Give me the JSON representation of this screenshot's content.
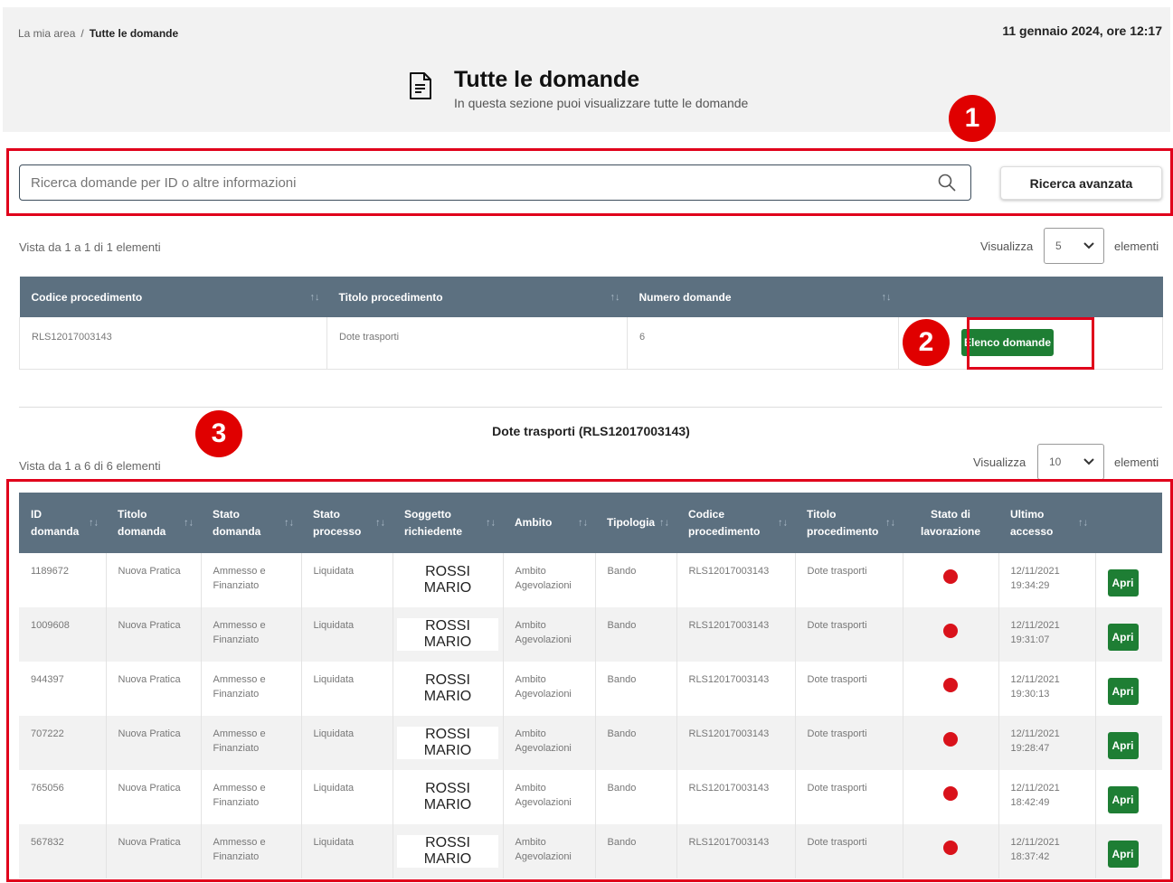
{
  "breadcrumb": {
    "home": "La mia area",
    "separator": "/",
    "current": "Tutte le domande"
  },
  "datetime": "11 gennaio 2024, ore 12:17",
  "header": {
    "title": "Tutte le domande",
    "subtitle": "In questa sezione puoi visualizzare tutte le domande"
  },
  "markers": [
    "1",
    "2",
    "3"
  ],
  "search": {
    "placeholder": "Ricerca domande per ID o altre informazioni",
    "advanced_label": "Ricerca avanzata"
  },
  "procedures": {
    "info": "Vista da 1 a 1 di 1 elementi",
    "show_label": "Visualizza",
    "page_size": "5",
    "elements_label": "elementi",
    "columns": [
      "Codice procedimento",
      "Titolo procedimento",
      "Numero domande"
    ],
    "rows": [
      {
        "codice": "RLS12017003143",
        "titolo": "Dote trasporti",
        "numero": "6",
        "action": "Elenco domande"
      }
    ]
  },
  "section_title": "Dote trasporti (RLS12017003143)",
  "applications": {
    "info": "Vista da 1 a 6 di 6 elementi",
    "show_label": "Visualizza",
    "page_size": "10",
    "elements_label": "elementi",
    "columns": [
      [
        "ID",
        "domanda"
      ],
      [
        "Titolo",
        "domanda"
      ],
      [
        "Stato",
        "domanda"
      ],
      [
        "Stato",
        "processo"
      ],
      [
        "Soggetto",
        "richiedente"
      ],
      [
        "Ambito",
        ""
      ],
      [
        "Tipologia",
        ""
      ],
      [
        "Codice",
        "procedimento"
      ],
      [
        "Titolo",
        "procedimento"
      ],
      [
        "Stato di",
        "lavorazione"
      ],
      [
        "Ultimo",
        "accesso"
      ]
    ],
    "status_color": "#d9121b",
    "action_label": "Apri",
    "rows": [
      {
        "id": "1189672",
        "titolo": "Nuova Pratica",
        "stato1": "Ammesso e",
        "stato2": "Finanziato",
        "processo": "Liquidata",
        "sog1": "ROSSI",
        "sog2": "MARIO",
        "amb1": "Ambito",
        "amb2": "Agevolazioni",
        "tipologia": "Bando",
        "codice": "RLS12017003143",
        "titolo_proc": "Dote trasporti",
        "data": "12/11/2021",
        "ora": "19:34:29"
      },
      {
        "id": "1009608",
        "titolo": "Nuova Pratica",
        "stato1": "Ammesso e",
        "stato2": "Finanziato",
        "processo": "Liquidata",
        "sog1": "ROSSI",
        "sog2": "MARIO",
        "amb1": "Ambito",
        "amb2": "Agevolazioni",
        "tipologia": "Bando",
        "codice": "RLS12017003143",
        "titolo_proc": "Dote trasporti",
        "data": "12/11/2021",
        "ora": "19:31:07"
      },
      {
        "id": "944397",
        "titolo": "Nuova Pratica",
        "stato1": "Ammesso e",
        "stato2": "Finanziato",
        "processo": "Liquidata",
        "sog1": "ROSSI",
        "sog2": "MARIO",
        "amb1": "Ambito",
        "amb2": "Agevolazioni",
        "tipologia": "Bando",
        "codice": "RLS12017003143",
        "titolo_proc": "Dote trasporti",
        "data": "12/11/2021",
        "ora": "19:30:13"
      },
      {
        "id": "707222",
        "titolo": "Nuova Pratica",
        "stato1": "Ammesso e",
        "stato2": "Finanziato",
        "processo": "Liquidata",
        "sog1": "ROSSI",
        "sog2": "MARIO",
        "amb1": "Ambito",
        "amb2": "Agevolazioni",
        "tipologia": "Bando",
        "codice": "RLS12017003143",
        "titolo_proc": "Dote trasporti",
        "data": "12/11/2021",
        "ora": "19:28:47"
      },
      {
        "id": "765056",
        "titolo": "Nuova Pratica",
        "stato1": "Ammesso e",
        "stato2": "Finanziato",
        "processo": "Liquidata",
        "sog1": "ROSSI",
        "sog2": "MARIO",
        "amb1": "Ambito",
        "amb2": "Agevolazioni",
        "tipologia": "Bando",
        "codice": "RLS12017003143",
        "titolo_proc": "Dote trasporti",
        "data": "12/11/2021",
        "ora": "18:42:49"
      },
      {
        "id": "567832",
        "titolo": "Nuova Pratica",
        "stato1": "Ammesso e",
        "stato2": "Finanziato",
        "processo": "Liquidata",
        "sog1": "ROSSI",
        "sog2": "MARIO",
        "amb1": "Ambito",
        "amb2": "Agevolazioni",
        "tipologia": "Bando",
        "codice": "RLS12017003143",
        "titolo_proc": "Dote trasporti",
        "data": "12/11/2021",
        "ora": "18:37:42"
      }
    ]
  }
}
